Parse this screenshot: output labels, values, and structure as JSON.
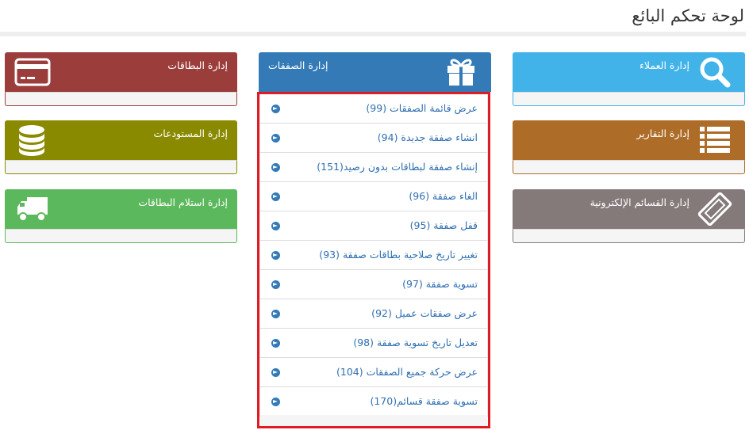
{
  "header": {
    "title": "لوحة تحكم البائع"
  },
  "panels": {
    "cards": {
      "label": "إدارة البطاقات",
      "icon": "credit-card-icon",
      "color": "#9b3d3b"
    },
    "warehouses": {
      "label": "إدارة المستودعات",
      "icon": "database-icon",
      "color": "#8a8a00"
    },
    "receive_cards": {
      "label": "إدارة استلام البطاقات",
      "icon": "truck-icon",
      "color": "#5cb85c"
    },
    "deals": {
      "label": "إدارة الصفقات",
      "icon": "gift-icon",
      "color": "#337ab7"
    },
    "customers": {
      "label": "إدارة العملاء",
      "icon": "search-icon",
      "color": "#41b3e9"
    },
    "reports": {
      "label": "إدارة التقارير",
      "icon": "list-icon",
      "color": "#ad6d28"
    },
    "vouchers": {
      "label": "إدارة القسائم الإلكترونية",
      "icon": "ticket-icon",
      "color": "#857a7a"
    }
  },
  "deals_menu": {
    "items": [
      {
        "label": "عرض قائمة الصفقات (99)"
      },
      {
        "label": "انشاء صفقة جديدة (94)"
      },
      {
        "label": "إنشاء صفقة لبطاقات بدون رصيد(151)"
      },
      {
        "label": "الغاء صفقة (96)"
      },
      {
        "label": "قفل صفقة (95)"
      },
      {
        "label": "تغيير تاريخ صلاحية بطاقات صفقة (93)"
      },
      {
        "label": "تسوية صفقة (97)"
      },
      {
        "label": "عرض صفقات عميل (92)"
      },
      {
        "label": "تعديل تاريخ تسوية صفقة (98)"
      },
      {
        "label": "عرض حركة جميع الصفقات (104)"
      },
      {
        "label": "تسوية صفقة قسائم(170)"
      }
    ],
    "highlight_color": "#e01b24"
  }
}
